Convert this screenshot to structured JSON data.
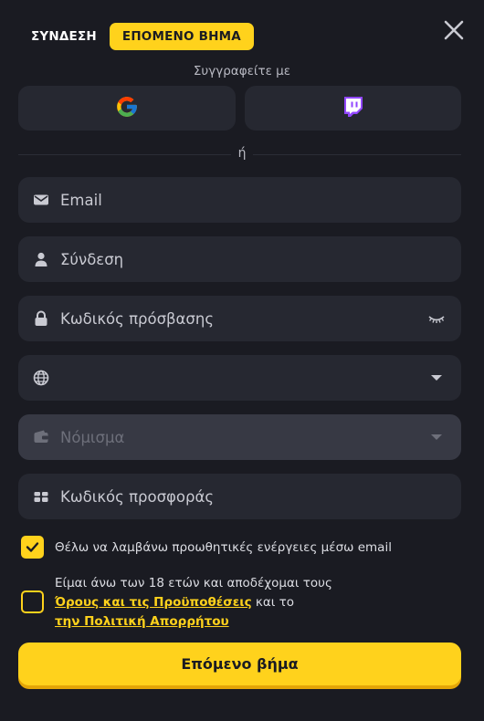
{
  "tabs": {
    "login_label": "ΣΥΝΔΕΣΗ",
    "next_step_label": "ΕΠΟΜΕΝΟ ΒΗΜΑ"
  },
  "social": {
    "subtitle": "Συγγραφείτε με",
    "google_icon": "google-g-logo",
    "twitch_icon": "twitch-logo",
    "twitch_color": "#9146ff"
  },
  "divider_text": "ή",
  "fields": {
    "email": {
      "placeholder": "Email",
      "icon": "envelope-icon"
    },
    "login": {
      "placeholder": "Σύνδεση",
      "icon": "user-icon"
    },
    "password": {
      "placeholder": "Κωδικός πρόσβασης",
      "icon": "lock-icon",
      "toggle_icon": "eye-closed-icon"
    },
    "country": {
      "value": "",
      "icon": "globe-icon"
    },
    "currency": {
      "placeholder": "Νόμισμα",
      "icon": "wallet-icon",
      "disabled": true
    },
    "promo": {
      "placeholder": "Κωδικός προσφοράς",
      "icon": "gift-icon"
    }
  },
  "consents": {
    "promo_emails": {
      "checked": true,
      "label": "Θέλω να λαμβάνω προωθητικές ενέργειες μέσω email"
    },
    "terms": {
      "checked": false,
      "text_before": "Είμαι άνω των 18 ετών και αποδέχομαι τους",
      "terms_link": "Όρους και τις Προϋποθέσεις",
      "text_middle": "και το",
      "privacy_link": "την Πολιτική Απορρήτου"
    }
  },
  "submit_label": "Επόμενο βήμα",
  "colors": {
    "background": "#1a1b22",
    "field": "#262831",
    "accent": "#ffd21c"
  }
}
